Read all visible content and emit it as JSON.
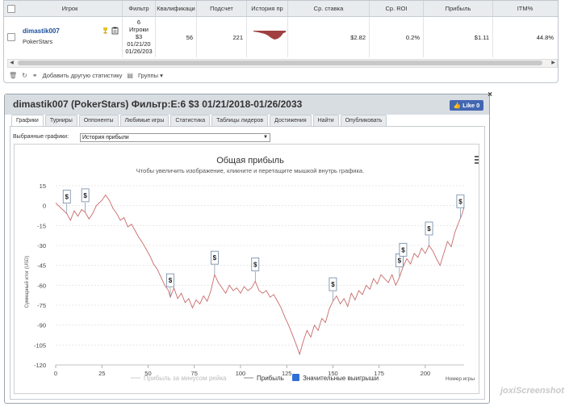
{
  "stats_table": {
    "columns": [
      "Игрок",
      "Фильтр",
      "Квалификаци",
      "Подсчет",
      "История пр",
      "Ср. ставка",
      "Ср. ROI",
      "Прибыль",
      "ITM%"
    ],
    "row": {
      "player": "dimastik007",
      "site": "PokerStars",
      "filter_lines": [
        "6",
        "Игроки",
        "$3",
        "01/21/20",
        "01/26/203"
      ],
      "qualification": "56",
      "count": "221",
      "avg_stake": "$2.82",
      "avg_roi": "0.2%",
      "profit": "$1.11",
      "itm": "44.8%"
    },
    "history_color": "#a04040"
  },
  "toolbar": {
    "add_stats": "Добавить другую статистику",
    "groups": "Группы"
  },
  "dialog": {
    "title": "dimastik007 (PokerStars) Фильтр:E:6 $3 01/21/2018-01/26/2033",
    "like": "Like 0",
    "tabs": [
      "Графики",
      "Турниры",
      "Оппоненты",
      "Любимые игры",
      "Статистика",
      "Таблицы лидеров",
      "Достижения",
      "Найти",
      "Опубликовать"
    ],
    "active_tab": 0,
    "select_label": "Выбранные графики:",
    "select_value": "История прибыли"
  },
  "chart_data": {
    "type": "line",
    "title": "Общая прибыль",
    "subtitle": "Чтобы увеличить изображение, кликните и перетащите мышкой внутрь графика.",
    "ylabel": "Суммарный итог (USD)",
    "xlabel": "Номер игры",
    "xlim": [
      0,
      221
    ],
    "ylim": [
      -120,
      15
    ],
    "xticks": [
      0,
      25,
      50,
      75,
      100,
      125,
      150,
      175,
      200
    ],
    "yticks": [
      15,
      0,
      -15,
      -30,
      -45,
      -60,
      -75,
      -90,
      -105,
      -120
    ],
    "line_color": "#c96a6a",
    "series": [
      {
        "name": "Прибыль",
        "points": [
          [
            0,
            2
          ],
          [
            3,
            -2
          ],
          [
            6,
            -6
          ],
          [
            8,
            -11
          ],
          [
            10,
            -4
          ],
          [
            12,
            -8
          ],
          [
            14,
            -3
          ],
          [
            16,
            -5
          ],
          [
            18,
            -10
          ],
          [
            20,
            -6
          ],
          [
            22,
            0
          ],
          [
            25,
            4
          ],
          [
            27,
            8
          ],
          [
            29,
            4
          ],
          [
            31,
            -2
          ],
          [
            33,
            -6
          ],
          [
            35,
            -11
          ],
          [
            37,
            -9
          ],
          [
            39,
            -16
          ],
          [
            41,
            -14
          ],
          [
            43,
            -19
          ],
          [
            45,
            -24
          ],
          [
            47,
            -28
          ],
          [
            49,
            -33
          ],
          [
            51,
            -38
          ],
          [
            53,
            -44
          ],
          [
            55,
            -48
          ],
          [
            57,
            -54
          ],
          [
            59,
            -60
          ],
          [
            61,
            -64
          ],
          [
            62,
            -69
          ],
          [
            64,
            -62
          ],
          [
            66,
            -70
          ],
          [
            68,
            -66
          ],
          [
            70,
            -73
          ],
          [
            72,
            -70
          ],
          [
            74,
            -77
          ],
          [
            76,
            -71
          ],
          [
            78,
            -74
          ],
          [
            80,
            -68
          ],
          [
            82,
            -72
          ],
          [
            84,
            -64
          ],
          [
            86,
            -52
          ],
          [
            88,
            -58
          ],
          [
            90,
            -62
          ],
          [
            92,
            -66
          ],
          [
            94,
            -60
          ],
          [
            96,
            -64
          ],
          [
            98,
            -62
          ],
          [
            100,
            -66
          ],
          [
            102,
            -61
          ],
          [
            104,
            -64
          ],
          [
            106,
            -62
          ],
          [
            108,
            -57
          ],
          [
            110,
            -64
          ],
          [
            112,
            -66
          ],
          [
            114,
            -64
          ],
          [
            116,
            -69
          ],
          [
            118,
            -67
          ],
          [
            120,
            -72
          ],
          [
            122,
            -77
          ],
          [
            124,
            -84
          ],
          [
            126,
            -90
          ],
          [
            128,
            -97
          ],
          [
            130,
            -104
          ],
          [
            132,
            -112
          ],
          [
            134,
            -102
          ],
          [
            136,
            -94
          ],
          [
            138,
            -99
          ],
          [
            140,
            -90
          ],
          [
            142,
            -94
          ],
          [
            144,
            -85
          ],
          [
            146,
            -88
          ],
          [
            148,
            -78
          ],
          [
            150,
            -72
          ],
          [
            152,
            -68
          ],
          [
            154,
            -74
          ],
          [
            156,
            -70
          ],
          [
            158,
            -76
          ],
          [
            160,
            -66
          ],
          [
            162,
            -71
          ],
          [
            164,
            -64
          ],
          [
            166,
            -67
          ],
          [
            168,
            -60
          ],
          [
            170,
            -63
          ],
          [
            172,
            -55
          ],
          [
            174,
            -59
          ],
          [
            176,
            -52
          ],
          [
            178,
            -55
          ],
          [
            180,
            -58
          ],
          [
            182,
            -52
          ],
          [
            184,
            -60
          ],
          [
            186,
            -54
          ],
          [
            188,
            -46
          ],
          [
            190,
            -40
          ],
          [
            192,
            -44
          ],
          [
            194,
            -36
          ],
          [
            196,
            -39
          ],
          [
            198,
            -32
          ],
          [
            200,
            -36
          ],
          [
            202,
            -30
          ],
          [
            204,
            -34
          ],
          [
            206,
            -40
          ],
          [
            208,
            -45
          ],
          [
            210,
            -36
          ],
          [
            212,
            -27
          ],
          [
            214,
            -31
          ],
          [
            216,
            -20
          ],
          [
            218,
            -13
          ],
          [
            220,
            -6
          ],
          [
            221,
            -1
          ]
        ]
      }
    ],
    "big_wins_x": [
      6,
      16,
      62,
      86,
      108,
      150,
      186,
      188,
      202,
      219
    ],
    "legend": [
      "Прибыль за минусом рейка",
      "Прибыль",
      "Значительные выигрыши"
    ],
    "legend_colors": [
      "#cccccc",
      "#888888",
      "#2f6fd6"
    ],
    "grid": true,
    "legend_position": "bottom"
  },
  "watermark": "joxiScreenshot"
}
